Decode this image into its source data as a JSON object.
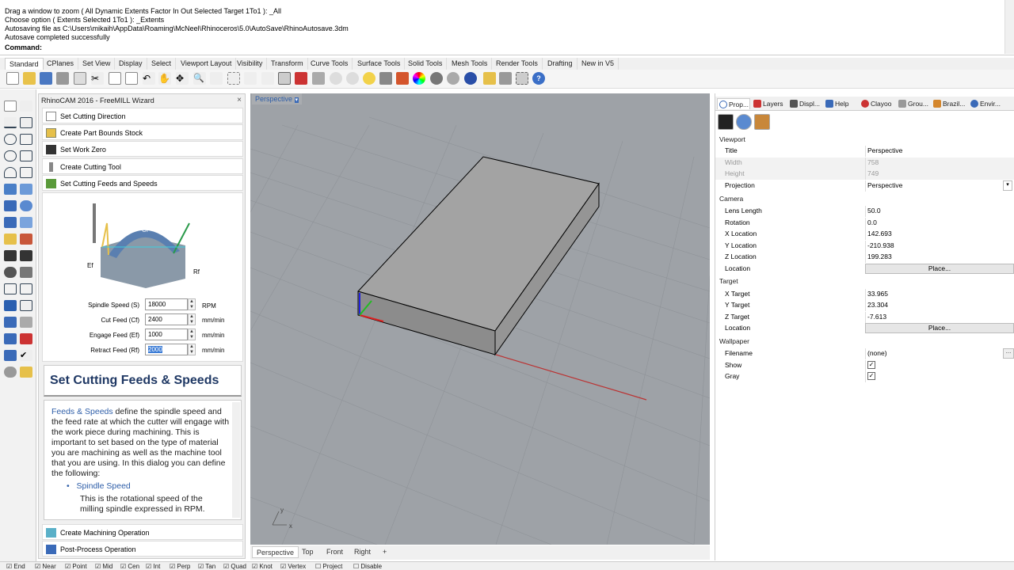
{
  "command_log": {
    "lines": [
      "Drag a window to zoom ( All  Dynamic  Extents  Factor  In  Out  Selected  Target  1To1 ): _All",
      "Choose option ( Extents  Selected  1To1 ): _Extents",
      "Autosaving file as C:\\Users\\mikaih\\AppData\\Roaming\\McNeel\\Rhinoceros\\5.0\\AutoSave\\RhinoAutosave.3dm",
      "Autosave completed successfully"
    ],
    "prompt_label": "Command:"
  },
  "toolbar_tabs": [
    "Standard",
    "CPlanes",
    "Set View",
    "Display",
    "Select",
    "Viewport Layout",
    "Visibility",
    "Transform",
    "Curve Tools",
    "Surface Tools",
    "Solid Tools",
    "Mesh Tools",
    "Render Tools",
    "Drafting",
    "New in V5"
  ],
  "wizard": {
    "title": "RhinoCAM 2016 - FreeMILL Wizard",
    "close": "×",
    "steps": [
      "Set Cutting Direction",
      "Create Part Bounds Stock",
      "Set Work Zero",
      "Create Cutting Tool",
      "Set Cutting Feeds and Speeds"
    ],
    "diagram_labels": {
      "cf": "Cf",
      "ef": "Ef",
      "rf": "Rf"
    },
    "fields": [
      {
        "label": "Spindle Speed (S)",
        "value": "18000",
        "unit": "RPM"
      },
      {
        "label": "Cut Feed (Cf)",
        "value": "2400",
        "unit": "mm/min"
      },
      {
        "label": "Engage Feed (Ef)",
        "value": "1000",
        "unit": "mm/min"
      },
      {
        "label": "Retract Feed (Rf)",
        "value": "2000",
        "unit": "mm/min"
      }
    ],
    "help_title": "Set Cutting Feeds & Speeds",
    "help": {
      "link": "Feeds & Speeds",
      "text": " define the spindle speed and the feed rate at which the cutter will engage with the work piece during machining.  This is important to set based on the type of material you are machining as well as the machine tool that you are using.  In this dialog you can define the following:",
      "bullet": "Spindle Speed",
      "bullet_desc": "This is the rotational speed of the milling spindle expressed in RPM."
    },
    "bottom_steps": [
      "Create Machining Operation",
      "Post-Process Operation"
    ]
  },
  "viewport": {
    "label": "Perspective",
    "tabs": [
      "Perspective",
      "Top",
      "Front",
      "Right"
    ],
    "add_tab": "+",
    "axis_y": "y",
    "axis_x": "x"
  },
  "properties": {
    "tabs": [
      "Prop...",
      "Layers",
      "Displ...",
      "Help",
      "Clayoo",
      "Grou...",
      "Brazil...",
      "Envir..."
    ],
    "sections": {
      "viewport": "Viewport",
      "camera": "Camera",
      "target": "Target",
      "wallpaper": "Wallpaper"
    },
    "viewport_rows": [
      {
        "k": "Title",
        "v": "Perspective"
      },
      {
        "k": "Width",
        "v": "758"
      },
      {
        "k": "Height",
        "v": "749"
      },
      {
        "k": "Projection",
        "v": "Perspective"
      }
    ],
    "camera_rows": [
      {
        "k": "Lens Length",
        "v": "50.0"
      },
      {
        "k": "Rotation",
        "v": "0.0"
      },
      {
        "k": "X Location",
        "v": "142.693"
      },
      {
        "k": "Y Location",
        "v": "-210.938"
      },
      {
        "k": "Z Location",
        "v": "199.283"
      },
      {
        "k": "Location",
        "v": "Place..."
      }
    ],
    "target_rows": [
      {
        "k": "X Target",
        "v": "33.965"
      },
      {
        "k": "Y Target",
        "v": "23.304"
      },
      {
        "k": "Z Target",
        "v": "-7.613"
      },
      {
        "k": "Location",
        "v": "Place..."
      }
    ],
    "wallpaper_rows": [
      {
        "k": "Filename",
        "v": "(none)"
      },
      {
        "k": "Show",
        "v": "✓"
      },
      {
        "k": "Gray",
        "v": "✓"
      }
    ]
  },
  "status_osnaps": [
    "End",
    "Near",
    "Point",
    "Mid",
    "Cen",
    "Int",
    "Perp",
    "Tan",
    "Quad",
    "Knot",
    "Vertex",
    "Project",
    "Disable"
  ]
}
